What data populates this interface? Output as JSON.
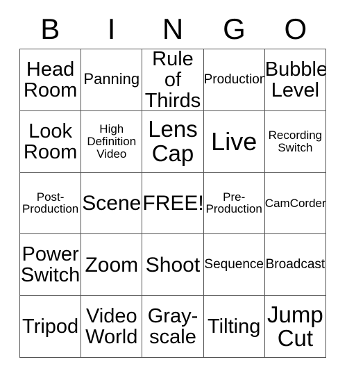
{
  "card": {
    "header_letters": [
      "B",
      "I",
      "N",
      "G",
      "O"
    ],
    "free_space_label": "FREE!",
    "rows": [
      [
        {
          "label": "Head\nRoom",
          "size": "s-md"
        },
        {
          "label": "Panning",
          "size": "s-sm"
        },
        {
          "label": "Rule of\nThirds",
          "size": "s-md"
        },
        {
          "label": "Production",
          "size": "s-xs"
        },
        {
          "label": "Bubble-\nLevel",
          "size": "s-md"
        }
      ],
      [
        {
          "label": "Look\nRoom",
          "size": "s-md"
        },
        {
          "label": "High\nDefinition\nVideo",
          "size": "s-xxs"
        },
        {
          "label": "Lens\nCap",
          "size": "s-xl"
        },
        {
          "label": "Live",
          "size": "s-xxl"
        },
        {
          "label": "Recording\nSwitch",
          "size": "s-xxs"
        }
      ],
      [
        {
          "label": "Post-\nProduction",
          "size": "s-xxs"
        },
        {
          "label": "Scene",
          "size": "s-lg"
        },
        {
          "label": "FREE!",
          "size": "s-lg"
        },
        {
          "label": "Pre-\nProduction",
          "size": "s-xxs"
        },
        {
          "label": "CamCorder",
          "size": "s-xxs"
        }
      ],
      [
        {
          "label": "Power\nSwitch",
          "size": "s-md"
        },
        {
          "label": "Zoom",
          "size": "s-lg"
        },
        {
          "label": "Shoot",
          "size": "s-lg"
        },
        {
          "label": "Sequence",
          "size": "s-xs"
        },
        {
          "label": "Broadcast",
          "size": "s-xs"
        }
      ],
      [
        {
          "label": "Tripod",
          "size": "s-md"
        },
        {
          "label": "Video\nWorld",
          "size": "s-md"
        },
        {
          "label": "Gray-\nscale",
          "size": "s-md"
        },
        {
          "label": "Tilting",
          "size": "s-md"
        },
        {
          "label": "Jump\nCut",
          "size": "s-xl"
        }
      ]
    ]
  },
  "colors": {
    "background": "#ffffff",
    "text": "#000000",
    "border": "#555555"
  }
}
